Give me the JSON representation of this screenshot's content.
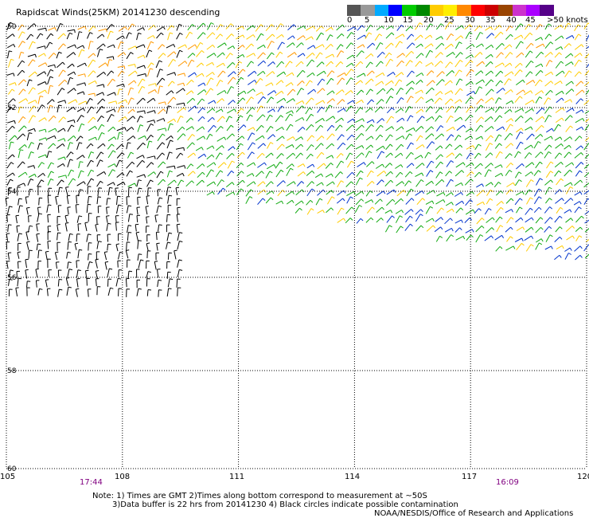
{
  "title": "Rapidscat Winds(25KM) 20141230 descending",
  "legend": {
    "colors": [
      "#555555",
      "#999999",
      "#00aaff",
      "#0000ff",
      "#00cc00",
      "#008800",
      "#ffcc00",
      "#ffee00",
      "#ff8800",
      "#ff0000",
      "#cc0000",
      "#994400",
      "#cc33cc",
      "#aa00ff",
      "#550088"
    ],
    "labels": [
      "0",
      "5",
      "10",
      "15",
      "20",
      "25",
      "30",
      "35",
      "40",
      "45",
      ">50 knots"
    ],
    "units": "knots"
  },
  "map": {
    "lat_labels": [
      "50",
      "52",
      "54",
      "56",
      "58",
      "60"
    ],
    "lon_labels": [
      "105",
      "108",
      "111",
      "114",
      "117",
      "120"
    ],
    "lon_range": [
      105,
      120
    ],
    "lat_range": [
      -50,
      -60
    ],
    "grid": "dotted",
    "times": [
      "17:44",
      "16:09"
    ],
    "time_color": "#800080",
    "wind_colors": {
      "low": "#000000",
      "blue": "#0033cc",
      "green": "#11aa11",
      "yellow": "#ffcc00",
      "orange": "#ff9900"
    }
  },
  "notes": {
    "line1": "Note: 1) Times are GMT 2)Times along bottom correspond to measurement at ~50S",
    "line2": "3)Data buffer is 22 hrs from 20141230 4) Black circles indicate possible contamination",
    "credit": "NOAA/NESDIS/Office of Research and Applications"
  }
}
